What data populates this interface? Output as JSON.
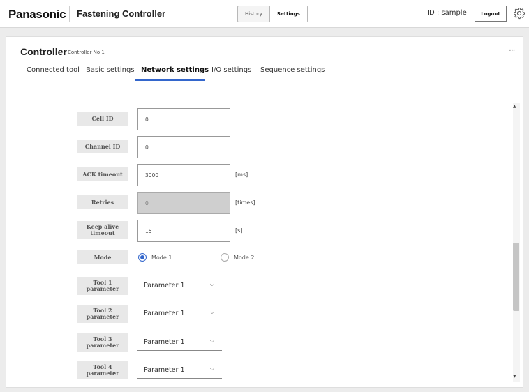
{
  "header": {
    "brand": "Panasonic",
    "app_title": "Fastening Controller",
    "nav": [
      "History",
      "Settings"
    ],
    "user_id": "ID : sample",
    "logout_label": "Logout"
  },
  "panel": {
    "title": "Controller",
    "subtitle": "Controller No 1",
    "more_label": "···",
    "tabs": [
      "Connected tool",
      "Basic settings",
      "Network settings",
      "I/O settings",
      "Sequence settings"
    ],
    "active_tab": "Network settings"
  },
  "form": {
    "cell_id": {
      "label": "Cell ID",
      "value": "0"
    },
    "channel_id": {
      "label": "Channel ID",
      "value": "0"
    },
    "ack_timeout": {
      "label": "ACK timeout",
      "value": "3000",
      "unit": "[ms]"
    },
    "retries": {
      "label": "Retries",
      "value": "0",
      "unit": "[times]"
    },
    "keep_alive": {
      "label_line1": "Keep alive",
      "label_line2": "timeout",
      "value": "15",
      "unit": "[s]"
    },
    "mode": {
      "label": "Mode",
      "options": [
        "Mode 1",
        "Mode 2"
      ],
      "selected": "Mode 1"
    },
    "tool_params": [
      {
        "label_line1": "Tool 1",
        "label_line2": "parameter",
        "value": "Parameter 1"
      },
      {
        "label_line1": "Tool 2",
        "label_line2": "parameter",
        "value": "Parameter 1"
      },
      {
        "label_line1": "Tool 3",
        "label_line2": "parameter",
        "value": "Parameter 1"
      },
      {
        "label_line1": "Tool 4",
        "label_line2": "parameter",
        "value": "Parameter 1"
      }
    ]
  },
  "colors": {
    "accent": "#3366cc",
    "label_bg": "#e8e8e8"
  },
  "icons": {
    "settings": "gear-icon",
    "more": "more-icon",
    "select_arrow": "chevron-down-icon"
  }
}
